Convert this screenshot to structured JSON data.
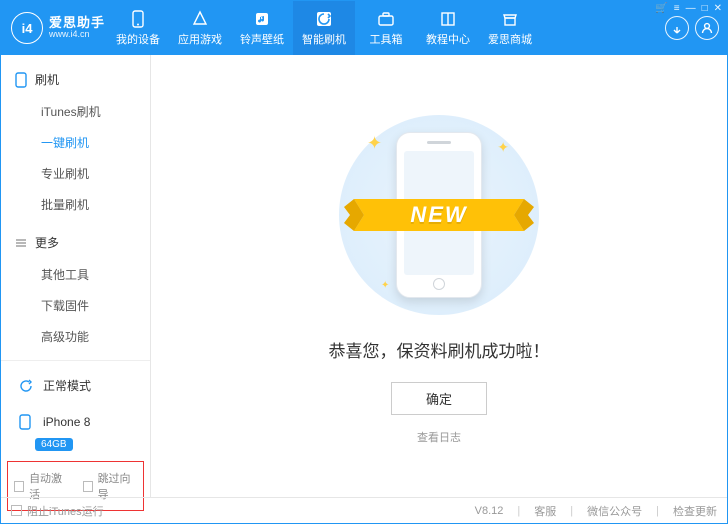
{
  "brand": {
    "logo_text": "i4",
    "name": "爱思助手",
    "url": "www.i4.cn"
  },
  "nav": {
    "items": [
      {
        "label": "我的设备",
        "icon": "phone-icon"
      },
      {
        "label": "应用游戏",
        "icon": "apps-icon"
      },
      {
        "label": "铃声壁纸",
        "icon": "music-icon"
      },
      {
        "label": "智能刷机",
        "icon": "flash-icon"
      },
      {
        "label": "工具箱",
        "icon": "toolbox-icon"
      },
      {
        "label": "教程中心",
        "icon": "book-icon"
      },
      {
        "label": "爱思商城",
        "icon": "store-icon"
      }
    ],
    "active_index": 3
  },
  "header_right": {
    "sync_title": "sync",
    "user_title": "user"
  },
  "window_controls": {
    "cart": "🛒",
    "menu": "≡",
    "min": "—",
    "max": "□",
    "close": "✕"
  },
  "sidebar": {
    "section1": {
      "title": "刷机",
      "items": [
        {
          "label": "iTunes刷机"
        },
        {
          "label": "一键刷机"
        },
        {
          "label": "专业刷机"
        },
        {
          "label": "批量刷机"
        }
      ],
      "active_index": 1
    },
    "section2": {
      "title": "更多",
      "items": [
        {
          "label": "其他工具"
        },
        {
          "label": "下载固件"
        },
        {
          "label": "高级功能"
        }
      ]
    },
    "mode_label": "正常模式",
    "device": {
      "name": "iPhone 8",
      "storage": "64GB"
    },
    "footer": {
      "auto_activate": "自动激活",
      "skip_guide": "跳过向导"
    }
  },
  "main": {
    "ribbon_text": "NEW",
    "congrats": "恭喜您，保资料刷机成功啦！",
    "ok_label": "确定",
    "viewlog_label": "查看日志"
  },
  "bottombar": {
    "block_itunes": "阻止iTunes运行",
    "version": "V8.12",
    "support": "客服",
    "wechat": "微信公众号",
    "update": "检查更新"
  }
}
